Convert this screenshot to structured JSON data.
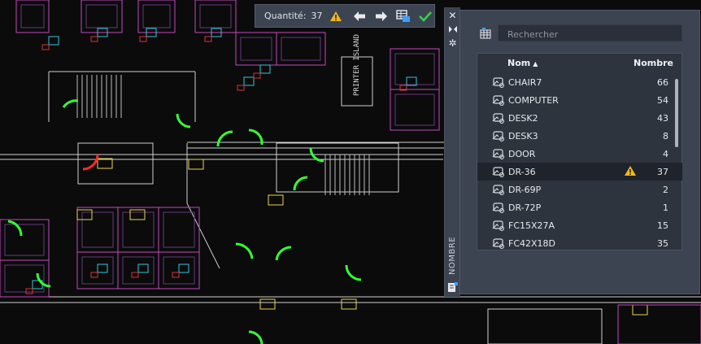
{
  "toolbar": {
    "quantity_label": "Quantité:",
    "quantity_value": "37",
    "icons": [
      "warning-icon",
      "arrow-left-icon",
      "arrow-right-icon",
      "insert-table-icon",
      "checkmark-icon"
    ]
  },
  "side_strip": {
    "title": "NOMBRE",
    "icons": [
      "close-icon",
      "auto-hide-icon",
      "settings-icon",
      "count-table-icon"
    ]
  },
  "palette": {
    "search_placeholder": "Rechercher",
    "headers": {
      "name": "Nom",
      "sort_arrow": "▲",
      "count": "Nombre"
    },
    "rows": [
      {
        "name": "CHAIR7",
        "count": "66",
        "selected": false,
        "warning": false
      },
      {
        "name": "COMPUTER",
        "count": "54",
        "selected": false,
        "warning": false
      },
      {
        "name": "DESK2",
        "count": "43",
        "selected": false,
        "warning": false
      },
      {
        "name": "DESK3",
        "count": "8",
        "selected": false,
        "warning": false
      },
      {
        "name": "DOOR",
        "count": "4",
        "selected": false,
        "warning": false
      },
      {
        "name": "DR-36",
        "count": "37",
        "selected": true,
        "warning": true
      },
      {
        "name": "DR-69P",
        "count": "2",
        "selected": false,
        "warning": false
      },
      {
        "name": "DR-72P",
        "count": "1",
        "selected": false,
        "warning": false
      },
      {
        "name": "FC15X27A",
        "count": "15",
        "selected": false,
        "warning": false
      },
      {
        "name": "FC42X18D",
        "count": "35",
        "selected": false,
        "warning": false
      }
    ]
  },
  "drawing": {
    "room_label": "PRINTER ISLAND",
    "colors": {
      "background": "#0b0b0c",
      "highlight": "#33ff33",
      "selected": "#ff2a2a",
      "walls": "#c04bb8",
      "yellow": "#e8d44a"
    }
  }
}
